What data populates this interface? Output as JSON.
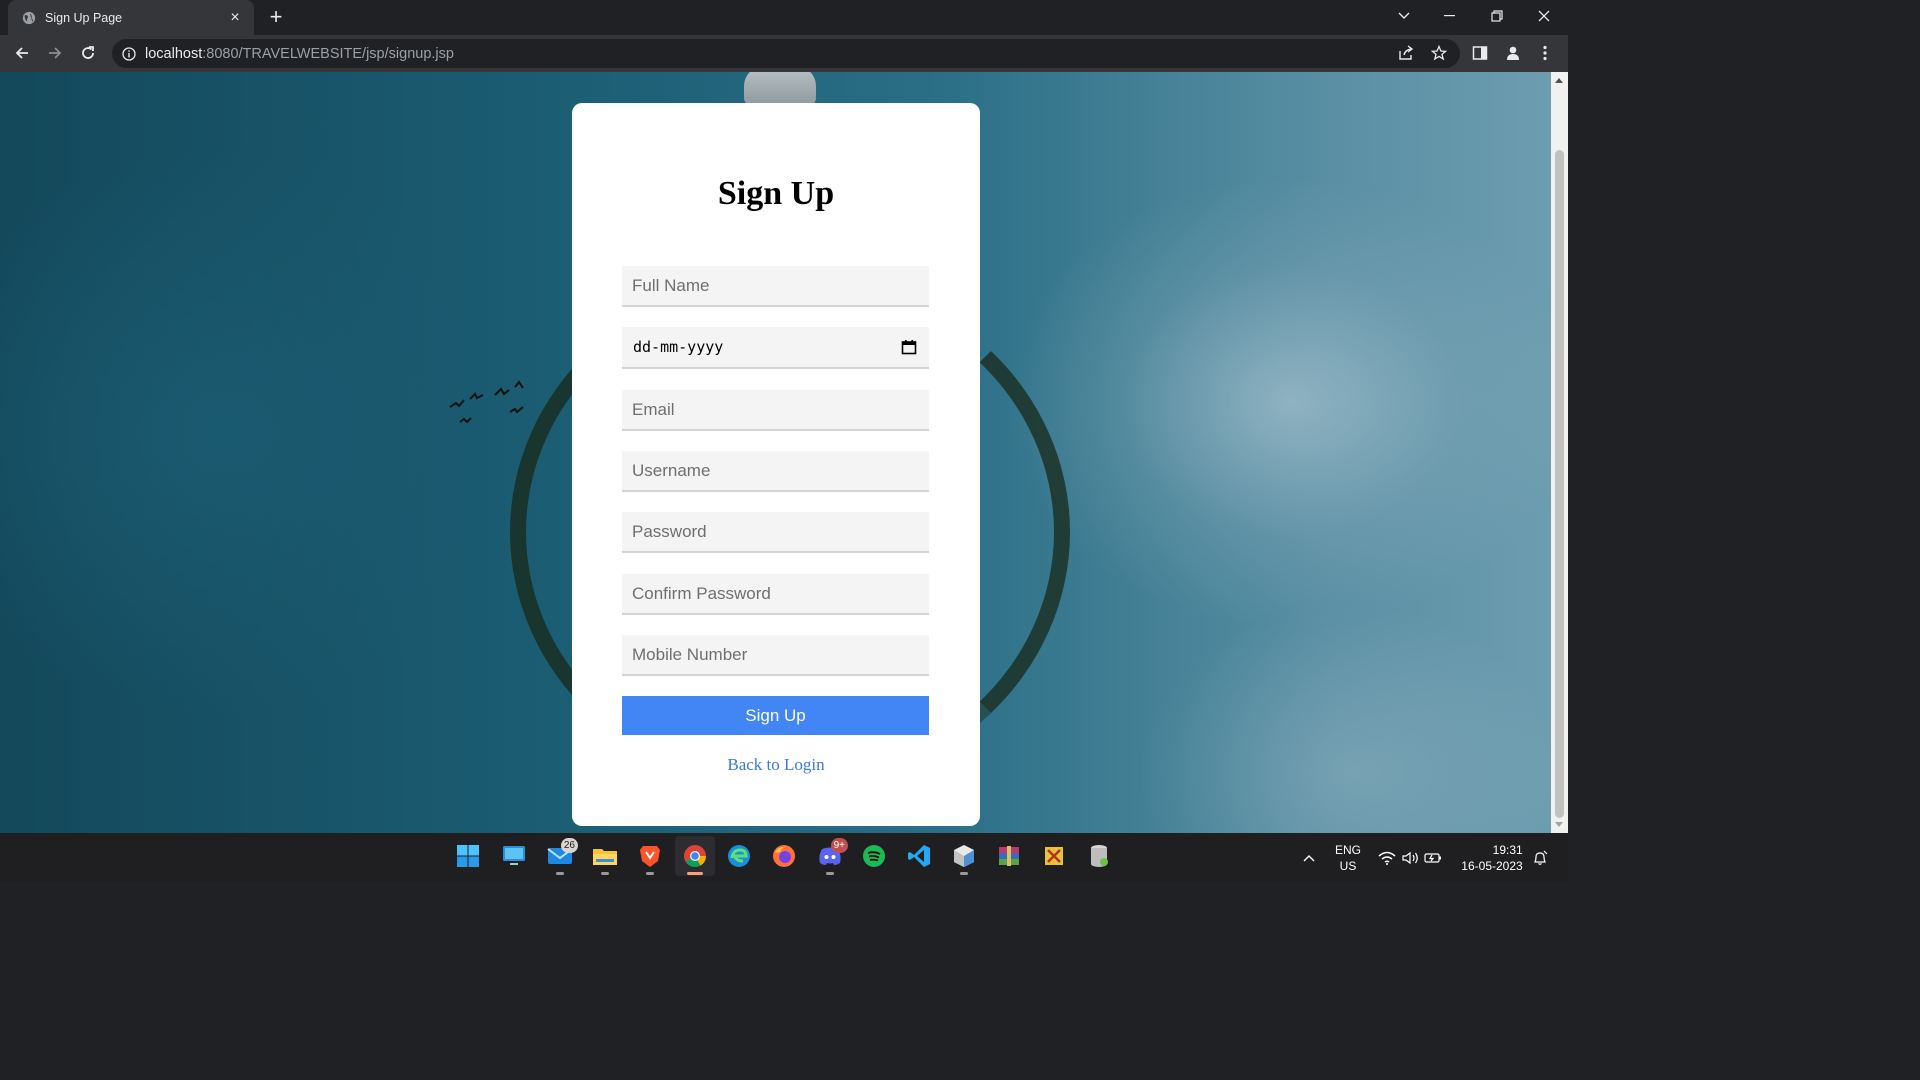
{
  "browser": {
    "tab_title": "Sign Up Page",
    "tab_close": "×",
    "new_tab": "+",
    "url_host": "localhost",
    "url_rest": ":8080/TRAVELWEBSITE/jsp/signup.jsp"
  },
  "signup": {
    "heading": "Sign Up",
    "full_name_placeholder": "Full Name",
    "dob_placeholder": "dd-mm-yyyy",
    "email_placeholder": "Email",
    "username_placeholder": "Username",
    "password_placeholder": "Password",
    "confirm_password_placeholder": "Confirm Password",
    "mobile_placeholder": "Mobile Number",
    "submit_label": "Sign Up",
    "back_link": "Back to Login"
  },
  "taskbar": {
    "mail_badge": "26",
    "discord_badge": "9+",
    "language": "ENG",
    "region": "US",
    "time": "19:31",
    "date": "16-05-2023"
  },
  "colors": {
    "primary_button": "#4285f4",
    "link": "#3b78e7",
    "card": "#ffffff"
  }
}
